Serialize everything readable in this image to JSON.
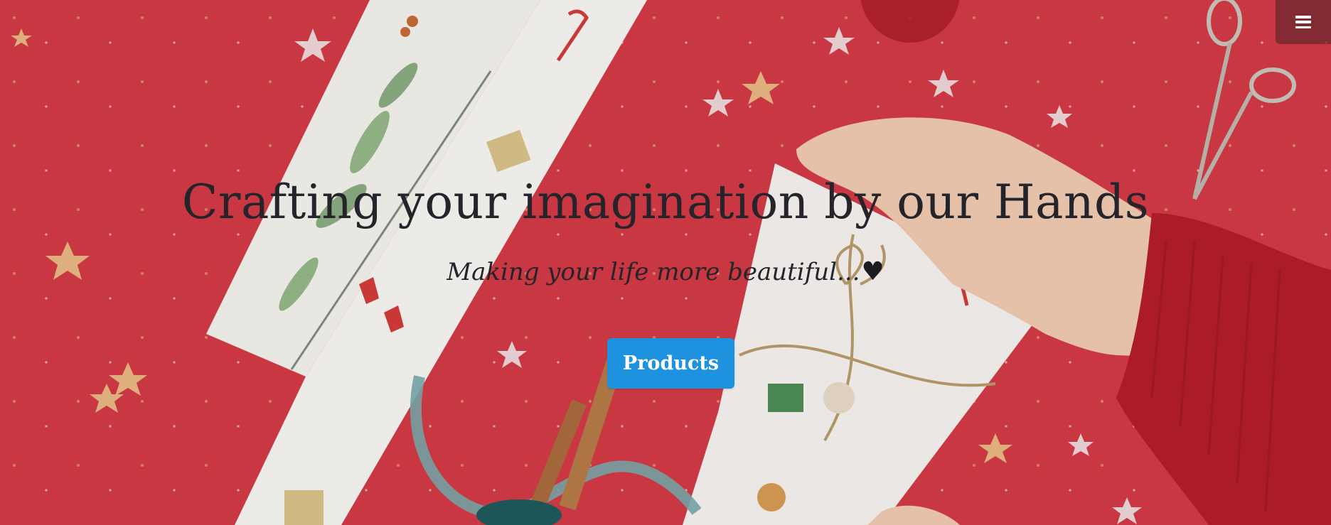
{
  "hero": {
    "title": "Crafting your imagination by our Hands",
    "subtitle": "Making your life more beautiful...",
    "subtitle_icon": "heart-icon",
    "cta_label": "Products",
    "background_image": "christmas-gift-wrapping-photo"
  },
  "nav": {
    "menu_icon": "hamburger-menu-icon"
  },
  "colors": {
    "background_red": "#d23a45",
    "text_dark": "#24242a",
    "button_blue": "#1e92de",
    "menu_bg": "#6e2830"
  }
}
